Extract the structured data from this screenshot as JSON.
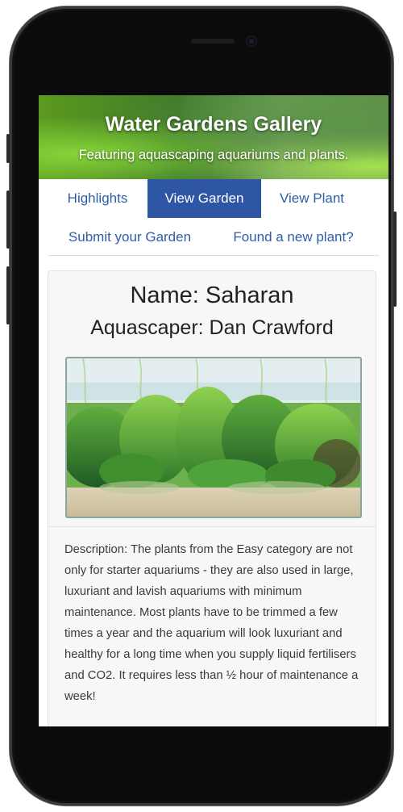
{
  "header": {
    "title": "Water Gardens Gallery",
    "subtitle": "Featuring aquascaping aquariums and plants."
  },
  "nav": {
    "items": [
      {
        "label": "Highlights",
        "active": false
      },
      {
        "label": "View Garden",
        "active": true
      },
      {
        "label": "View Plant",
        "active": false
      },
      {
        "label": "Submit your Garden",
        "active": false
      },
      {
        "label": "Found a new plant?",
        "active": false
      }
    ]
  },
  "garden": {
    "name": "Name: Saharan",
    "aquascaper": "Aquascaper: Dan Crawford",
    "image_icon": "aquarium-photo",
    "description": "Description: The plants from the Easy category are not only for starter aquariums - they are also used in large, luxuriant and lavish aquariums with minimum maintenance. Most plants have to be trimmed a few times a year and the aquarium will look luxuriant and healthy for a long time when you supply liquid fertilisers and CO2. It requires less than ½ hour of maintenance a week!"
  },
  "colors": {
    "link": "#2c5fa8",
    "active_tab": "#2f56a5"
  }
}
